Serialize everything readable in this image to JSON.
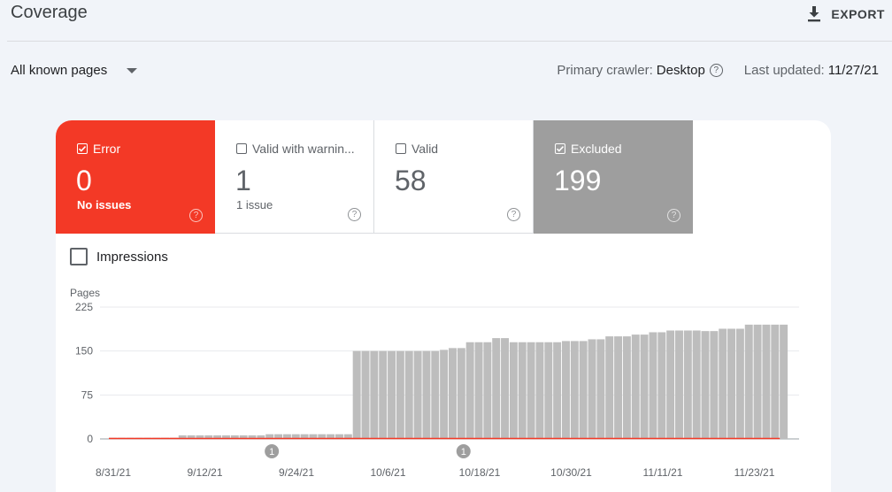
{
  "header": {
    "title": "Coverage",
    "export_label": "EXPORT"
  },
  "filter": {
    "selected": "All known pages"
  },
  "meta": {
    "crawler_label": "Primary crawler:",
    "crawler_value": "Desktop",
    "updated_label": "Last updated:",
    "updated_value": "11/27/21"
  },
  "tiles": [
    {
      "label": "Error",
      "value": "0",
      "sub": "No issues",
      "checked": true,
      "color": "#f33926"
    },
    {
      "label": "Valid with warnin...",
      "value": "1",
      "sub": "1 issue",
      "checked": false
    },
    {
      "label": "Valid",
      "value": "58",
      "sub": "",
      "checked": false
    },
    {
      "label": "Excluded",
      "value": "199",
      "sub": "",
      "checked": true,
      "color": "#9e9e9e"
    }
  ],
  "impressions": {
    "label": "Impressions",
    "checked": false
  },
  "chart_data": {
    "type": "bar",
    "ylabel": "Pages",
    "ylim": [
      0,
      225
    ],
    "yticks": [
      "0",
      "75",
      "150",
      "225"
    ],
    "ytick_values": [
      0,
      75,
      150,
      225
    ],
    "xticks": [
      "8/31/21",
      "9/12/21",
      "9/24/21",
      "10/6/21",
      "10/18/21",
      "10/30/21",
      "11/11/21",
      "11/23/21"
    ],
    "annotations": [
      "1",
      "1"
    ],
    "series": [
      {
        "color": "#bdbdbd",
        "values": [
          2,
          2,
          2,
          2,
          2,
          2,
          2,
          2,
          6,
          6,
          6,
          6,
          6,
          6,
          6,
          6,
          6,
          6,
          8,
          8,
          8,
          8,
          8,
          8,
          8,
          8,
          8,
          8,
          150,
          150,
          150,
          150,
          150,
          150,
          150,
          150,
          150,
          150,
          152,
          155,
          155,
          165,
          165,
          165,
          172,
          172,
          165,
          165,
          165,
          165,
          165,
          165,
          167,
          167,
          167,
          170,
          170,
          175,
          175,
          175,
          178,
          178,
          182,
          182,
          185,
          185,
          185,
          185,
          184,
          184,
          188,
          188,
          188,
          195,
          195,
          195,
          195,
          195
        ]
      },
      {
        "color": "#f33926",
        "values": [
          0,
          0,
          0,
          0,
          0,
          0,
          0,
          0,
          0,
          0,
          0,
          0,
          0,
          0,
          0,
          0,
          0,
          0,
          0,
          0,
          0,
          0,
          0,
          0,
          0,
          0,
          0,
          0,
          0,
          0,
          0,
          0,
          0,
          0,
          0,
          0,
          0,
          0,
          0,
          0,
          0,
          0,
          0,
          0,
          0,
          0,
          0,
          0,
          0,
          0,
          0,
          0,
          0,
          0,
          0,
          0,
          0,
          0,
          0,
          0,
          0,
          0,
          0,
          0,
          0,
          0,
          0,
          0,
          0,
          0,
          0,
          0,
          0,
          0,
          0,
          0,
          0,
          0
        ]
      }
    ]
  }
}
